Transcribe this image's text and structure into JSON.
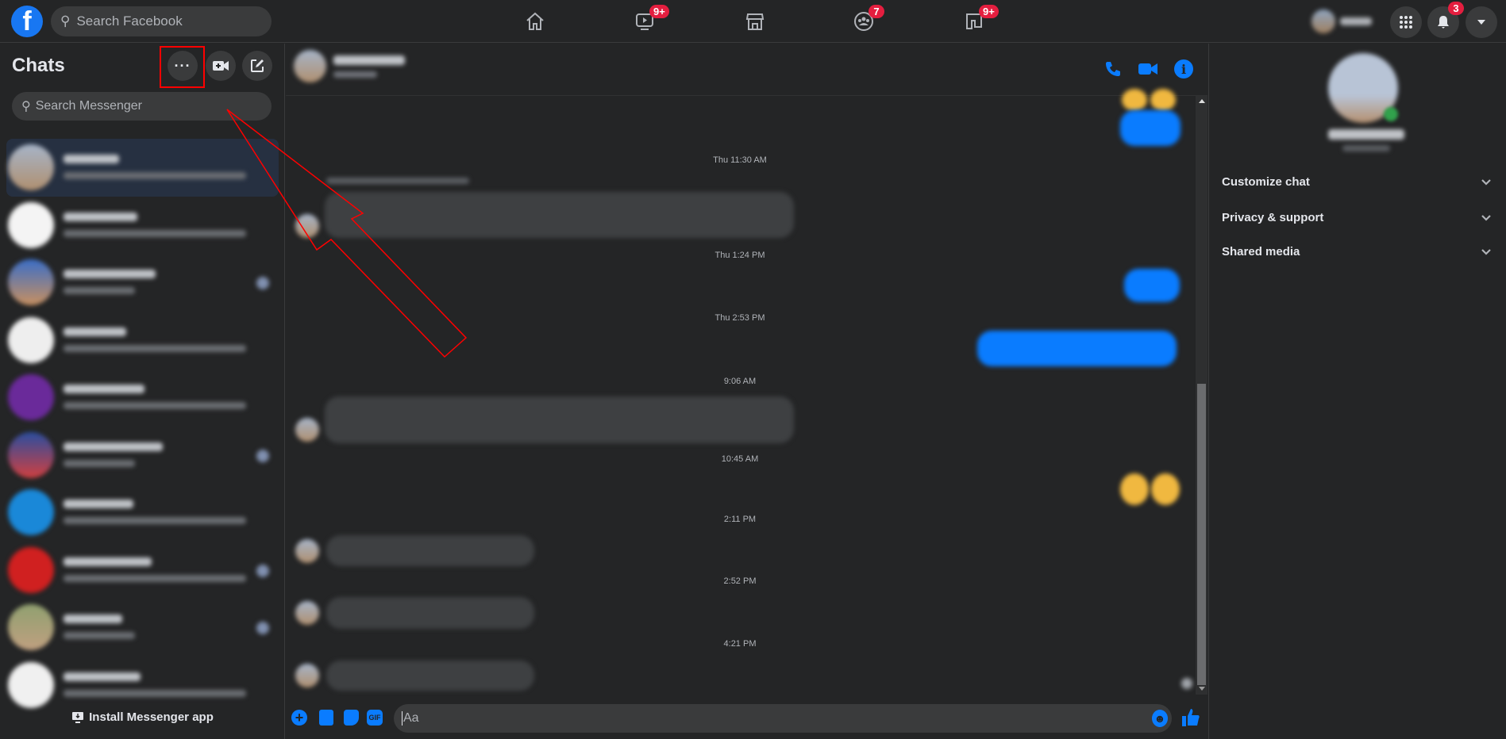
{
  "topbar": {
    "search_placeholder": "Search Facebook",
    "nav": [
      {
        "name": "home-icon",
        "badge": ""
      },
      {
        "name": "watch-icon",
        "badge": "9+"
      },
      {
        "name": "marketplace-icon",
        "badge": ""
      },
      {
        "name": "groups-icon",
        "badge": "7"
      },
      {
        "name": "gaming-icon",
        "badge": "9+"
      }
    ],
    "notifications_badge": "3"
  },
  "sidebar": {
    "title": "Chats",
    "search_placeholder": "Search Messenger",
    "install_label": "Install Messenger app",
    "chat_count_visible": 10
  },
  "conversation": {
    "timestamps": [
      "Thu 11:30 AM",
      "Thu 1:24 PM",
      "Thu 2:53 PM",
      "9:06 AM",
      "10:45 AM",
      "2:11 PM",
      "2:52 PM",
      "4:21 PM"
    ],
    "composer_placeholder": "Aa"
  },
  "right_panel": {
    "sections": [
      "Customize chat",
      "Privacy & support",
      "Shared media"
    ]
  },
  "colors": {
    "accent": "#0a7cff",
    "badge": "#e41e3f",
    "annotation": "#ff0000",
    "background": "#242526",
    "surface": "#3a3b3c"
  }
}
